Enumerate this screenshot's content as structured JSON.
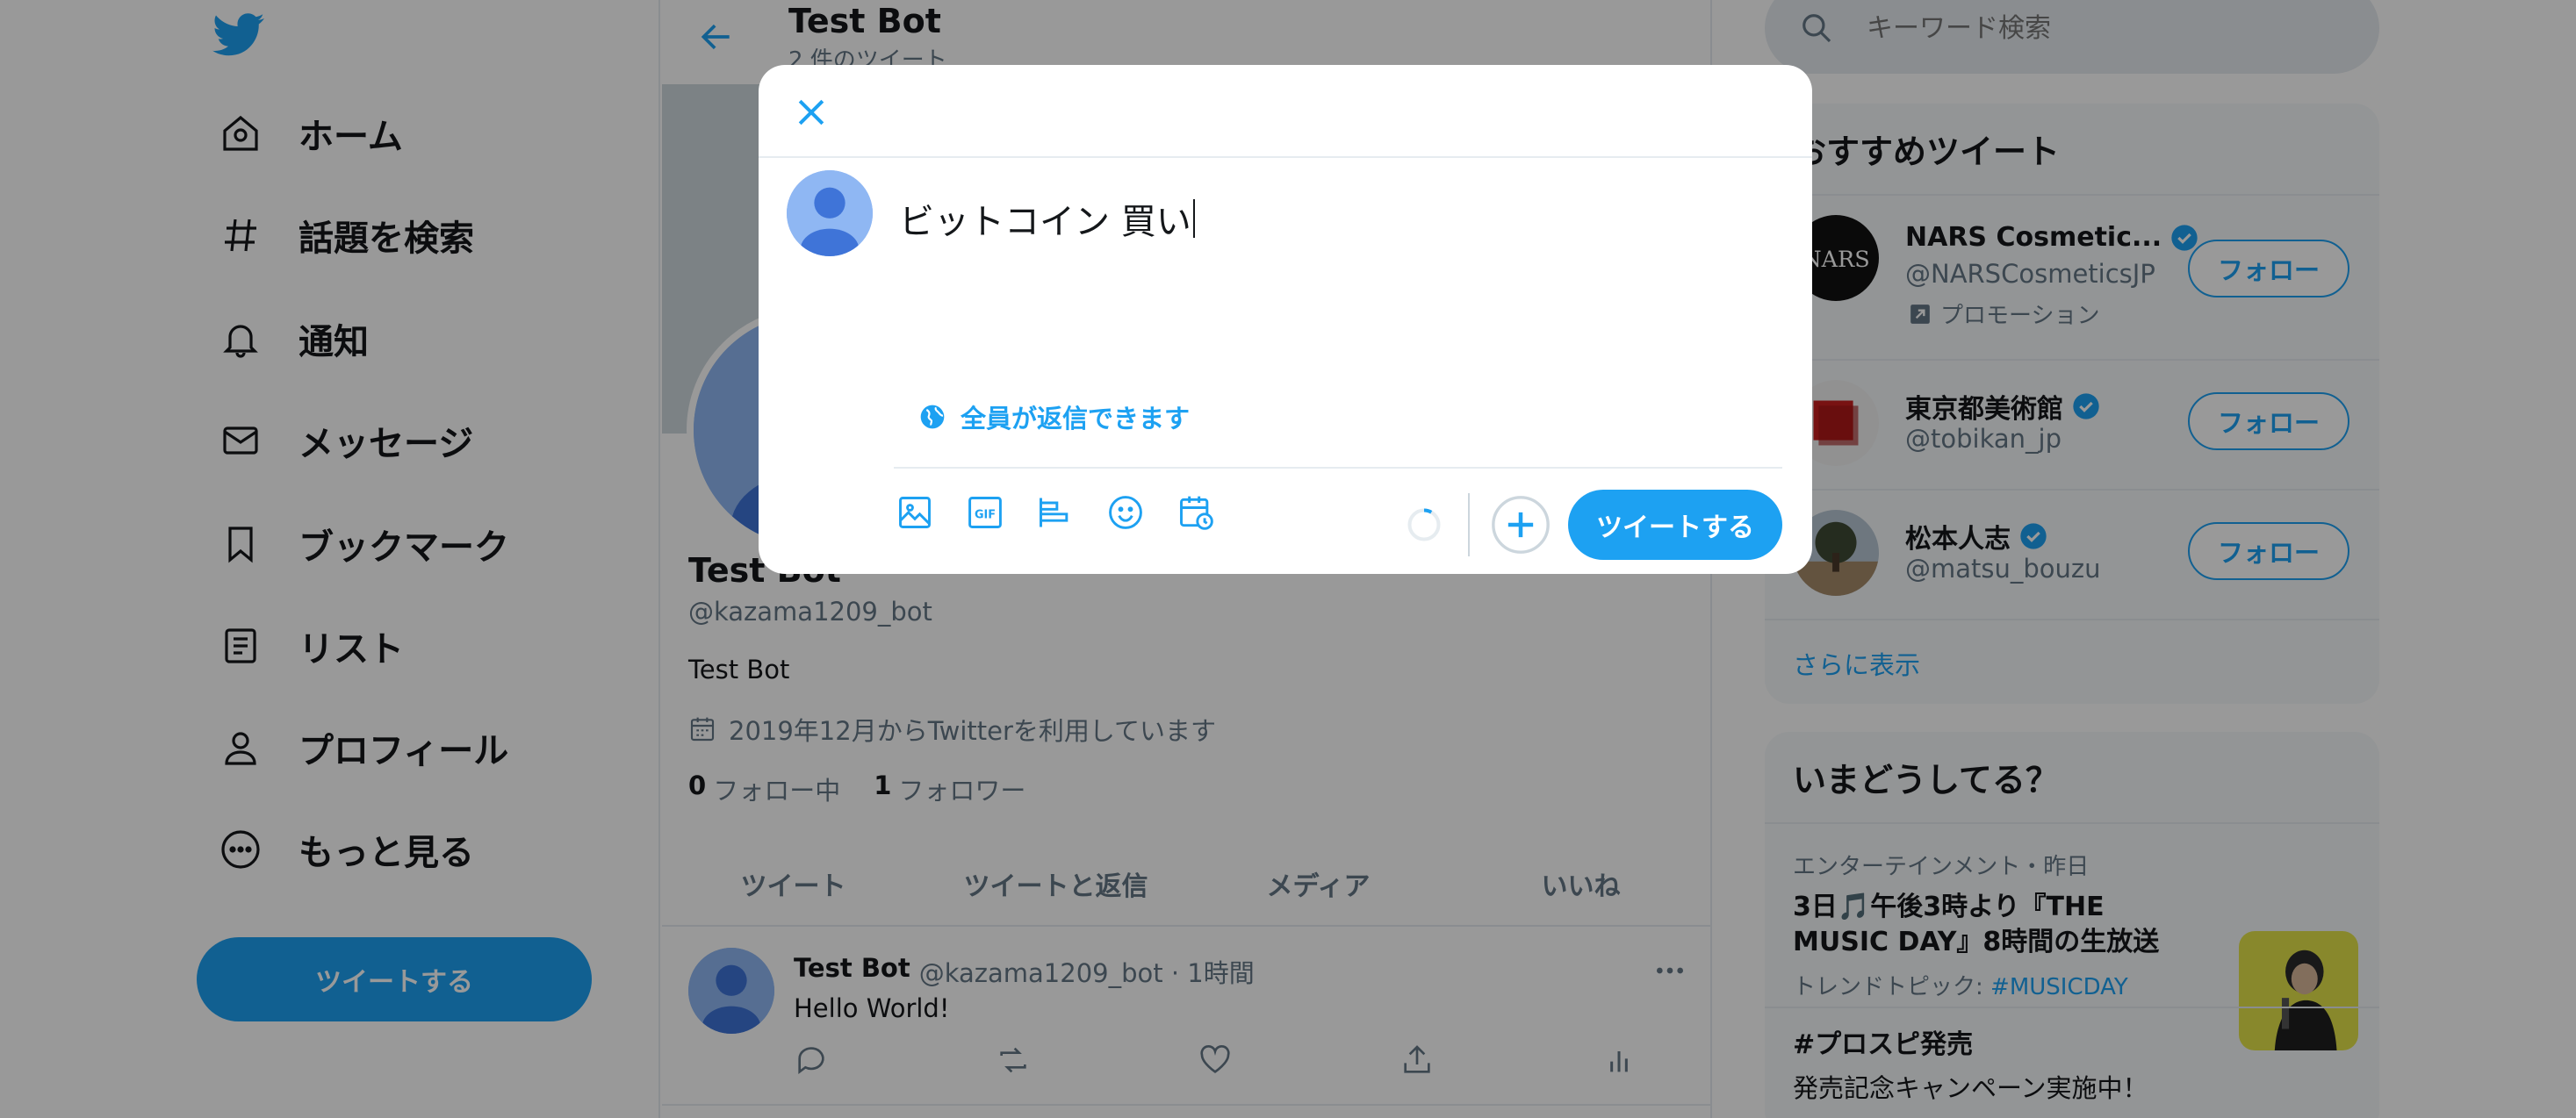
{
  "nav": {
    "items": [
      {
        "label": "ホーム",
        "icon": "home-icon"
      },
      {
        "label": "話題を検索",
        "icon": "hashtag-icon"
      },
      {
        "label": "通知",
        "icon": "bell-icon"
      },
      {
        "label": "メッセージ",
        "icon": "mail-icon"
      },
      {
        "label": "ブックマーク",
        "icon": "bookmark-icon"
      },
      {
        "label": "リスト",
        "icon": "list-icon"
      },
      {
        "label": "プロフィール",
        "icon": "person-icon"
      },
      {
        "label": "もっと見る",
        "icon": "more-circle-icon"
      }
    ],
    "tweet_button": "ツイートする"
  },
  "profile": {
    "header_title": "Test Bot",
    "header_subtitle": "2 件のツイート",
    "name": "Test Bot",
    "handle": "@kazama1209_bot",
    "bio": "Test Bot",
    "joined": "2019年12月からTwitterを利用しています",
    "following_count": "0",
    "following_label": "フォロー中",
    "followers_count": "1",
    "followers_label": "フォロワー",
    "tabs": [
      "ツイート",
      "ツイートと返信",
      "メディア",
      "いいね"
    ]
  },
  "timeline": {
    "tweet": {
      "name": "Test Bot",
      "meta": "@kazama1209_bot · 1時間",
      "text": "Hello World!"
    }
  },
  "right": {
    "search_placeholder": "キーワード検索",
    "recommend_title": "おすすめツイート",
    "recommendations": [
      {
        "name": "NARS Cosmetic...",
        "handle": "@NARSCosmeticsJP",
        "promo": "プロモーション",
        "button": "フォロー"
      },
      {
        "name": "東京都美術館",
        "handle": "@tobikan_jp",
        "button": "フォロー"
      },
      {
        "name": "松本人志",
        "handle": "@matsu_bouzu",
        "button": "フォロー"
      }
    ],
    "show_more": "さらに表示",
    "trends_title": "いまどうしてる？",
    "trends": [
      {
        "meta": "エンターテインメント・昨日",
        "title": "3日🎵午後3時より『THE MUSIC DAY』8時間の生放送",
        "sub_prefix": "トレンドトピック: ",
        "hashtag": "#MUSICDAY"
      },
      {
        "title": "#プロスピ発売",
        "sub": "発売記念キャンペーン実施中！"
      }
    ]
  },
  "modal": {
    "compose_text": "ビットコイン 買い",
    "reply_setting": "全員が返信できます",
    "tweet_button": "ツイートする"
  },
  "colors": {
    "accent": "#1da1f2",
    "text": "#14171a",
    "muted": "#657786",
    "border": "#e6ecf0",
    "overlay": "rgba(0,0,0,0.40)"
  }
}
